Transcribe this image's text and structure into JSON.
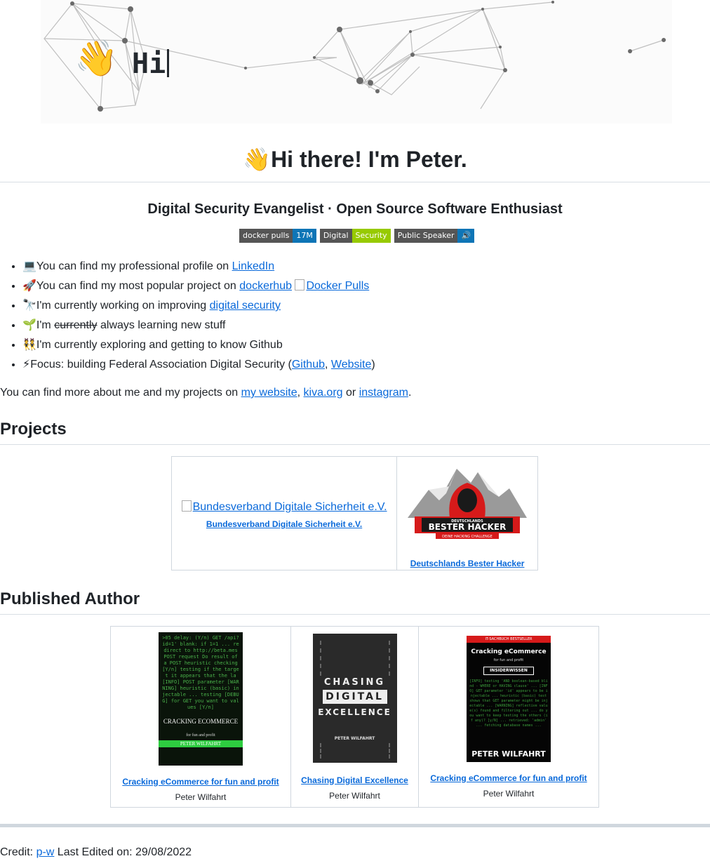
{
  "banner": {
    "greeting": "Hi"
  },
  "header": {
    "title": "Hi there! I'm Peter.",
    "subtitle": "Digital Security Evangelist · Open Source Software Enthusiast"
  },
  "badges": [
    {
      "left": "docker pulls",
      "right": "17M",
      "color": "#0e75b6"
    },
    {
      "left": "Digital",
      "right": "Security",
      "color": "#97ca00"
    },
    {
      "left": "Public Speaker",
      "right": "🔊",
      "color": "#0e75b6"
    }
  ],
  "facts": {
    "f1_text": "You can find my professional profile on ",
    "f1_link": "LinkedIn",
    "f2_text": "You can find my most popular project on ",
    "f2_link": "dockerhub",
    "f2_img": "Docker Pulls",
    "f3_text": "I'm currently working on improving ",
    "f3_link": "digital security",
    "f4_pre": "I'm ",
    "f4_strike": "currently",
    "f4_post": " always learning new stuff",
    "f5_text": "I'm currently exploring and getting to know Github",
    "f6_text": "Focus: building Federal Association Digital Security (",
    "f6_link1": "Github",
    "f6_sep": ", ",
    "f6_link2": "Website",
    "f6_end": ")"
  },
  "more": {
    "pre": "You can find more about me and my projects on ",
    "link1": "my website",
    "sep": ", ",
    "link2": "kiva.org",
    "or": " or ",
    "link3": "instagram",
    "end": "."
  },
  "projects": {
    "heading": "Projects",
    "items": [
      {
        "img_alt": "Bundesverband Digitale Sicherheit e.V.",
        "caption": "Bundesverband Digitale Sicherheit e.V."
      },
      {
        "logo_top": "DEUTSCHLANDS",
        "logo_main": "BESTER HACKER",
        "logo_sub": "DEINE HACKING CHALLENGE",
        "caption": "Deutschlands Bester Hacker"
      }
    ]
  },
  "author": {
    "heading": "Published Author",
    "books": [
      {
        "cover_title": "CRACKING ECOMMERCE",
        "cover_sub": "for fun and profit",
        "cover_author": "PETER WILFAHRT",
        "title": "Cracking eCommerce for fun and profit",
        "author": "Peter Wilfahrt"
      },
      {
        "cover_l1": "CHASING",
        "cover_l2": "DIGITAL",
        "cover_l3": "EXCELLENCE",
        "cover_author": "PETER WILFAHRT",
        "title": "Chasing Digital Excellence",
        "author": "Peter Wilfahrt"
      },
      {
        "cover_top": "IT-SACHBUCH BESTSELLER",
        "cover_title": "Cracking eCommerce",
        "cover_sub": "for fun and profit",
        "cover_badge": "INSIDERWISSEN",
        "cover_author": "PETER WILFAHRT",
        "title": "Cracking eCommerce for fun and profit",
        "author": "Peter Wilfahrt"
      }
    ]
  },
  "footer": {
    "credit": "Credit: ",
    "credit_link": "p-w",
    "edited": " Last Edited on: 29/08/2022"
  }
}
